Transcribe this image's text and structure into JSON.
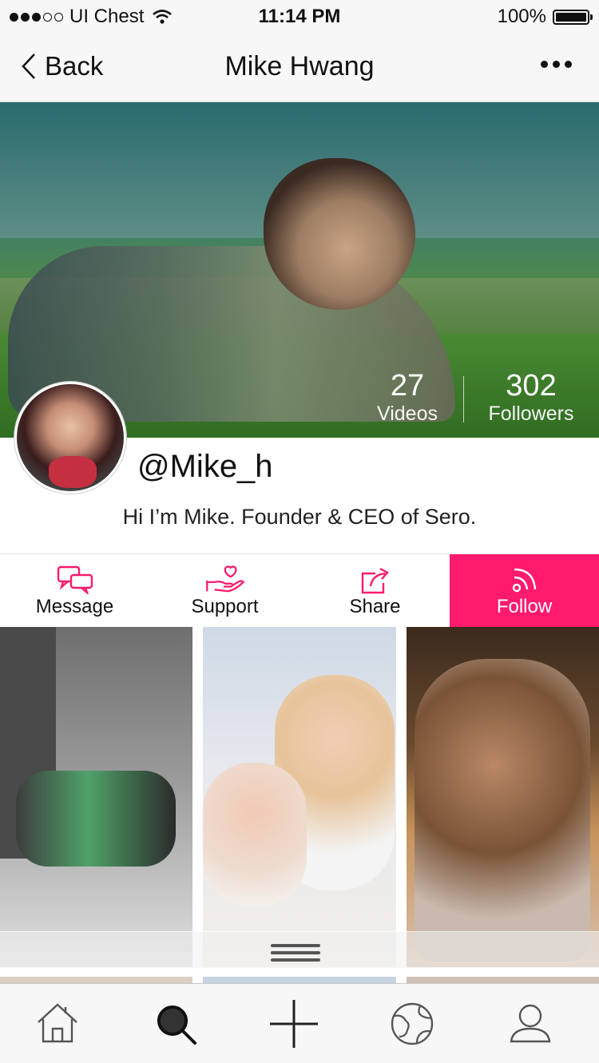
{
  "status_bar": {
    "carrier": "UI Chest",
    "time": "11:14 PM",
    "battery": "100%",
    "signal_dots": 5,
    "signal_filled": 3
  },
  "nav": {
    "back_label": "Back",
    "title": "Mike Hwang"
  },
  "profile": {
    "stats": [
      {
        "value": "27",
        "label": "Videos"
      },
      {
        "value": "302",
        "label": "Followers"
      }
    ],
    "username": "@Mike_h",
    "bio": "Hi I’m Mike. Founder & CEO of Sero."
  },
  "actions": {
    "message": "Message",
    "support": "Support",
    "share": "Share",
    "follow": "Follow"
  },
  "colors": {
    "accent": "#ff1a6e",
    "icon_accent": "#ff1a6e",
    "bar_bg": "#f7f7f7"
  },
  "icons": {
    "back": "chevron-left-icon",
    "more": "more-horizontal-icon",
    "message": "chat-bubbles-icon",
    "support": "heart-hand-icon",
    "share": "share-icon",
    "follow": "rss-icon",
    "tabs": [
      "home-icon",
      "search-icon",
      "plus-icon",
      "globe-icon",
      "profile-icon"
    ]
  }
}
